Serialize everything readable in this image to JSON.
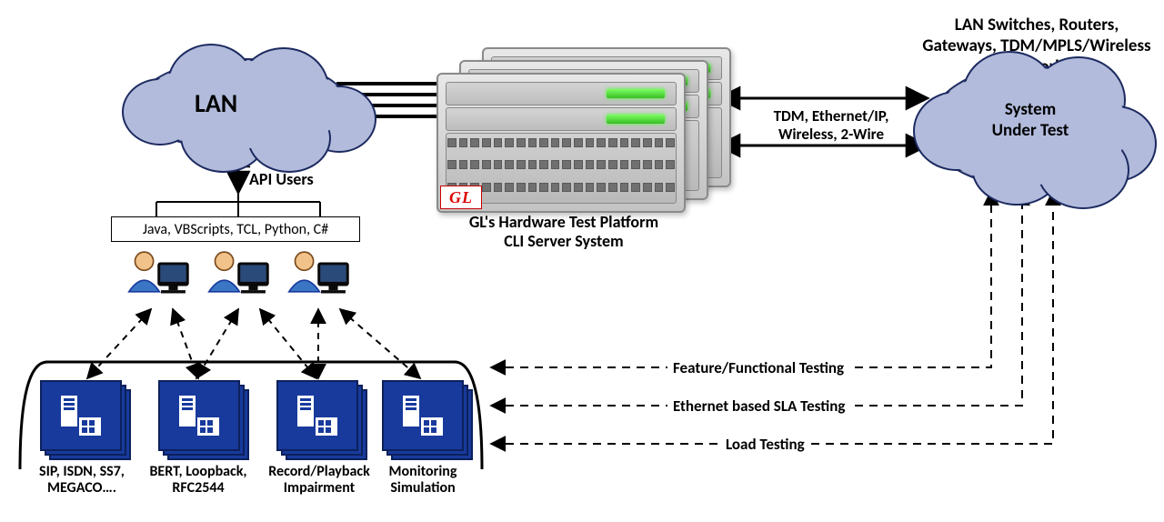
{
  "lan": {
    "label": "LAN"
  },
  "sut": {
    "title": "LAN Switches, Routers, Gateways, TDM/MPLS/Wireless networks",
    "label": "System\nUnder Test"
  },
  "api": {
    "title": "API Users",
    "languages": "Java, VBScripts, TCL, Python, C#"
  },
  "server": {
    "caption_line1": "GL's Hardware Test Platform",
    "caption_line2": "CLI Server System",
    "badge": "GL"
  },
  "connection_label": "TDM, Ethernet/IP,\nWireless, 2-Wire",
  "tiles": [
    {
      "label": "SIP, ISDN, SS7,\nMEGACO…."
    },
    {
      "label": "BERT, Loopback,\nRFC2544"
    },
    {
      "label": "Record/Playback\nImpairment"
    },
    {
      "label": "Monitoring\nSimulation"
    }
  ],
  "tests": [
    "Feature/Functional Testing",
    "Ethernet based SLA Testing",
    "Load Testing"
  ]
}
